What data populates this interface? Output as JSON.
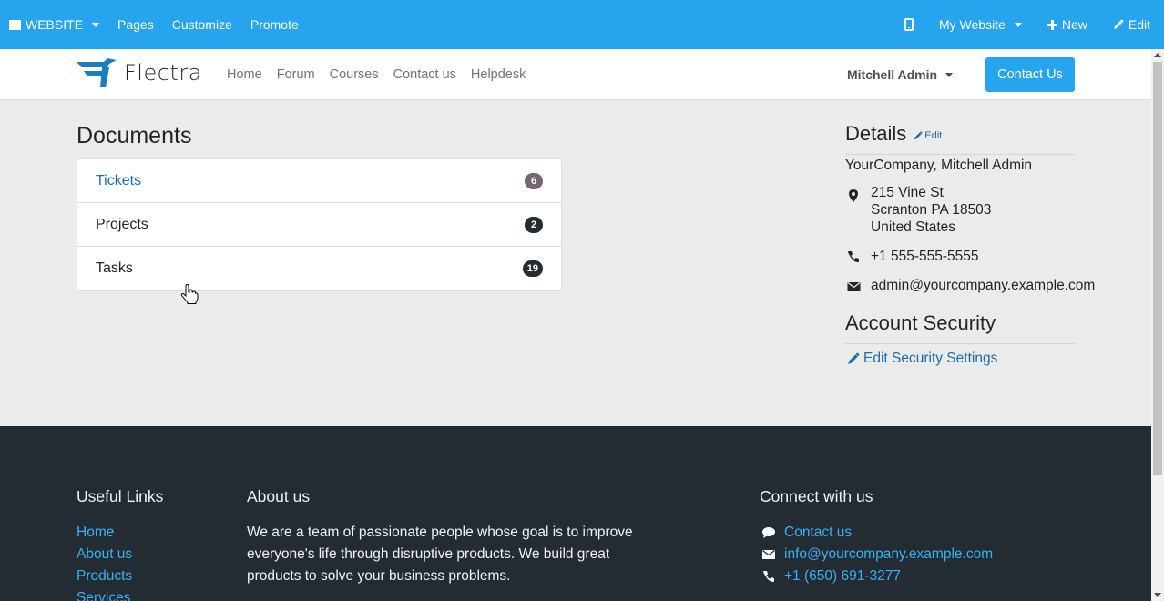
{
  "adminbar": {
    "website_label": "WEBSITE",
    "pages_label": "Pages",
    "customize_label": "Customize",
    "promote_label": "Promote",
    "my_website_label": "My Website",
    "new_label": "New",
    "edit_label": "Edit",
    "color": "#26a4ee"
  },
  "navbar": {
    "logo_text": "Flectra",
    "menu": [
      "Home",
      "Forum",
      "Courses",
      "Contact us",
      "Helpdesk"
    ],
    "user_name": "Mitchell Admin",
    "contact_button": "Contact Us"
  },
  "documents": {
    "title": "Documents",
    "items": [
      {
        "label": "Tickets",
        "count": "6",
        "badge_color": "#76666f"
      },
      {
        "label": "Projects",
        "count": "2",
        "badge_color": "#232c33"
      },
      {
        "label": "Tasks",
        "count": "19",
        "badge_color": "#232c33"
      }
    ]
  },
  "details": {
    "title": "Details",
    "edit_label": "Edit",
    "company": "YourCompany, Mitchell Admin",
    "address_line1": "215 Vine St",
    "address_line2": "Scranton PA 18503",
    "address_line3": "United States",
    "phone": "+1 555-555-5555",
    "email": "admin@yourcompany.example.com"
  },
  "security": {
    "title": "Account Security",
    "edit_link": "Edit Security Settings"
  },
  "footer": {
    "useful_links_title": "Useful Links",
    "useful_links": [
      "Home",
      "About us",
      "Products",
      "Services"
    ],
    "about_title": "About us",
    "about_text": "We are a team of passionate people whose goal is to improve everyone's life through disruptive products. We build great products to solve your business problems.",
    "connect_title": "Connect with us",
    "connect_contact": "Contact us",
    "connect_email": "info@yourcompany.example.com",
    "connect_phone": "+1 (650) 691-3277"
  }
}
